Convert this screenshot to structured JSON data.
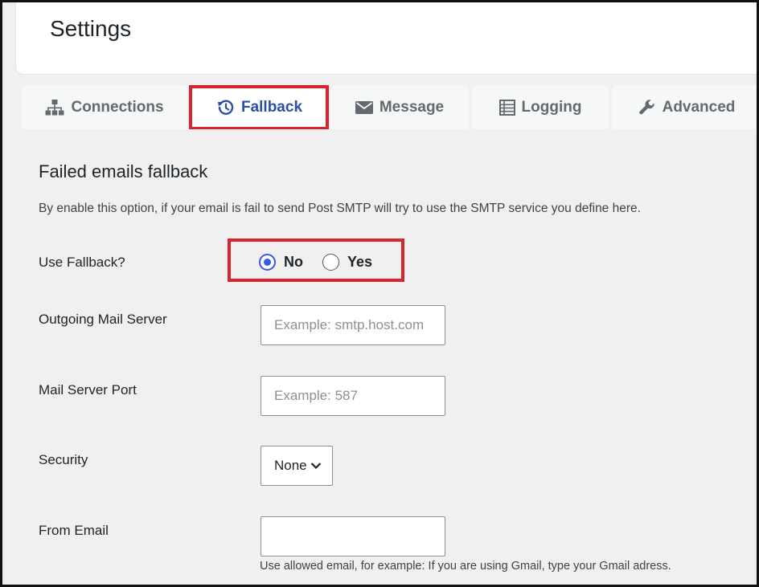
{
  "header": {
    "title": "Settings"
  },
  "tabs": [
    {
      "label": "Connections",
      "icon": "sitemap-icon",
      "active": false
    },
    {
      "label": "Fallback",
      "icon": "history-icon",
      "active": true
    },
    {
      "label": "Message",
      "icon": "envelope-icon",
      "active": false
    },
    {
      "label": "Logging",
      "icon": "list-icon",
      "active": false
    },
    {
      "label": "Advanced",
      "icon": "wrench-icon",
      "active": false
    }
  ],
  "section": {
    "title": "Failed emails fallback",
    "description": "By enable this option, if your email is fail to send Post SMTP will try to use the SMTP service you define here."
  },
  "fields": {
    "use_fallback": {
      "label": "Use Fallback?",
      "options": [
        {
          "label": "No",
          "checked": true
        },
        {
          "label": "Yes",
          "checked": false
        }
      ]
    },
    "server": {
      "label": "Outgoing Mail Server",
      "placeholder": "Example: smtp.host.com",
      "value": ""
    },
    "port": {
      "label": "Mail Server Port",
      "placeholder": "Example: 587",
      "value": ""
    },
    "security": {
      "label": "Security",
      "selected": "None"
    },
    "from_email": {
      "label": "From Email",
      "value": "",
      "hint": "Use allowed email, for example: If you are using Gmail, type your Gmail adress."
    }
  },
  "colors": {
    "accent": "#3858e9",
    "active_tab_text": "#2c4fa3",
    "highlight": "#d9232d"
  }
}
